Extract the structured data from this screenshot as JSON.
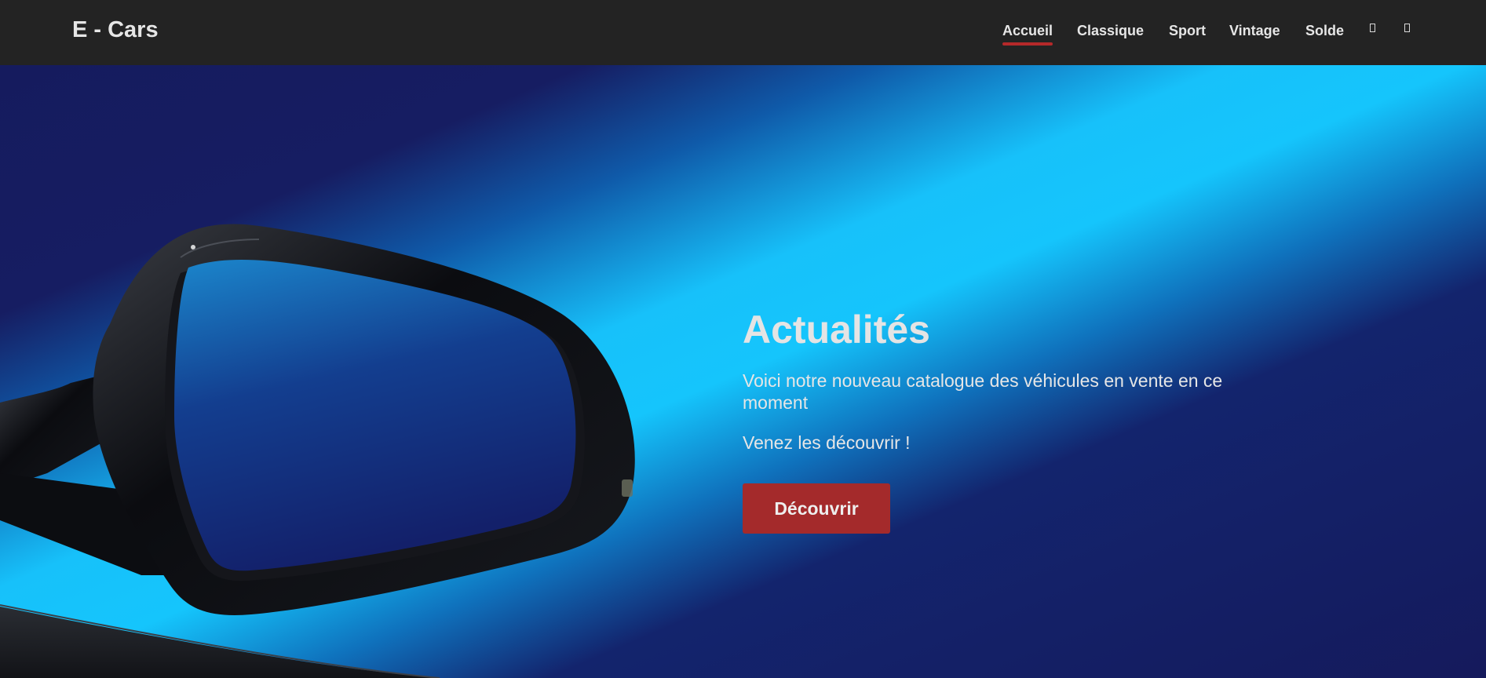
{
  "header": {
    "brand": "E - Cars",
    "nav": [
      {
        "label": "Accueil",
        "active": true
      },
      {
        "label": "Classique",
        "active": false
      },
      {
        "label": "Sport",
        "active": false
      },
      {
        "label": "Vintage",
        "active": false
      },
      {
        "label": "Solde",
        "active": false
      }
    ],
    "icons": [
      "missing-glyph-icon",
      "missing-glyph-icon"
    ]
  },
  "hero": {
    "title": "Actualités",
    "paragraphs": [
      "Voici notre nouveau catalogue des véhicules en vente en ce moment",
      "Venez les découvrir !"
    ],
    "button_label": "Découvrir"
  },
  "colors": {
    "navbar_bg": "#232323",
    "accent_red": "#a42a2b",
    "hero_dark_blue": "#151a5c",
    "hero_light_blue": "#15c5fc",
    "text_light": "#e6e6e6"
  }
}
